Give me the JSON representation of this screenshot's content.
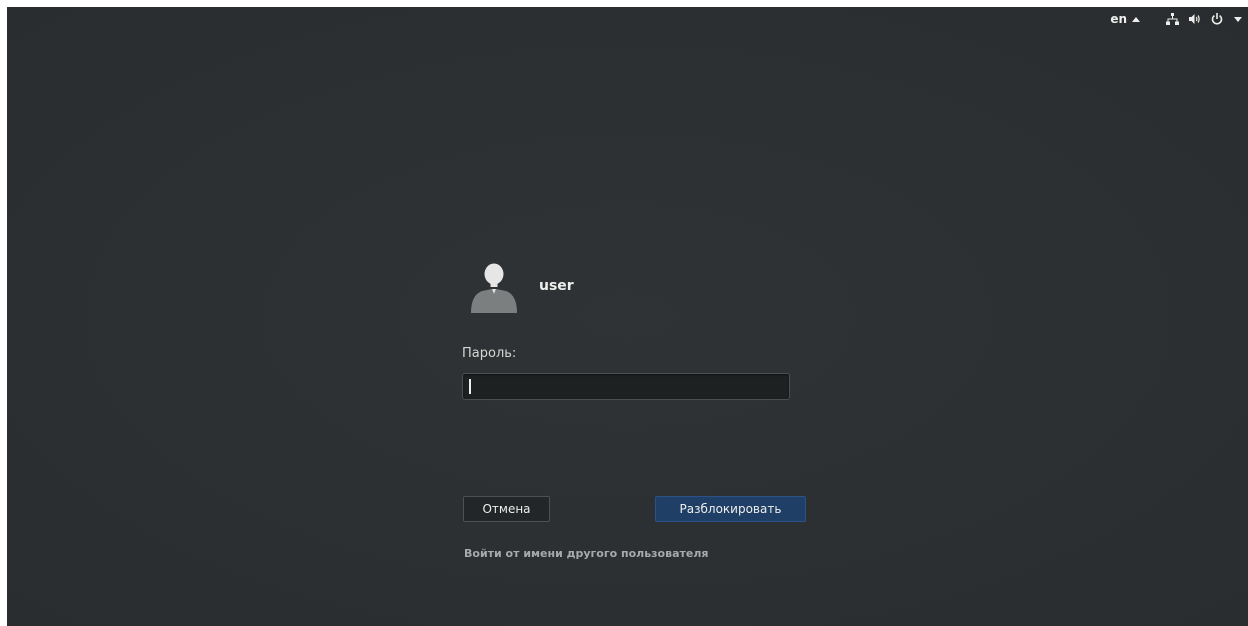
{
  "topbar": {
    "language": "en",
    "icons": [
      "network-icon",
      "volume-icon",
      "power-icon",
      "menu-caret-icon"
    ]
  },
  "user": {
    "name": "user",
    "avatar_icon": "avatar-icon"
  },
  "password": {
    "label": "Пароль:",
    "value": ""
  },
  "buttons": {
    "cancel": "Отмена",
    "unlock": "Разблокировать"
  },
  "links": {
    "other_user": "Войти от имени другого пользователя"
  },
  "colors": {
    "background": "#2c3032",
    "accent": "#1f3f66",
    "text": "#eeeeec"
  }
}
